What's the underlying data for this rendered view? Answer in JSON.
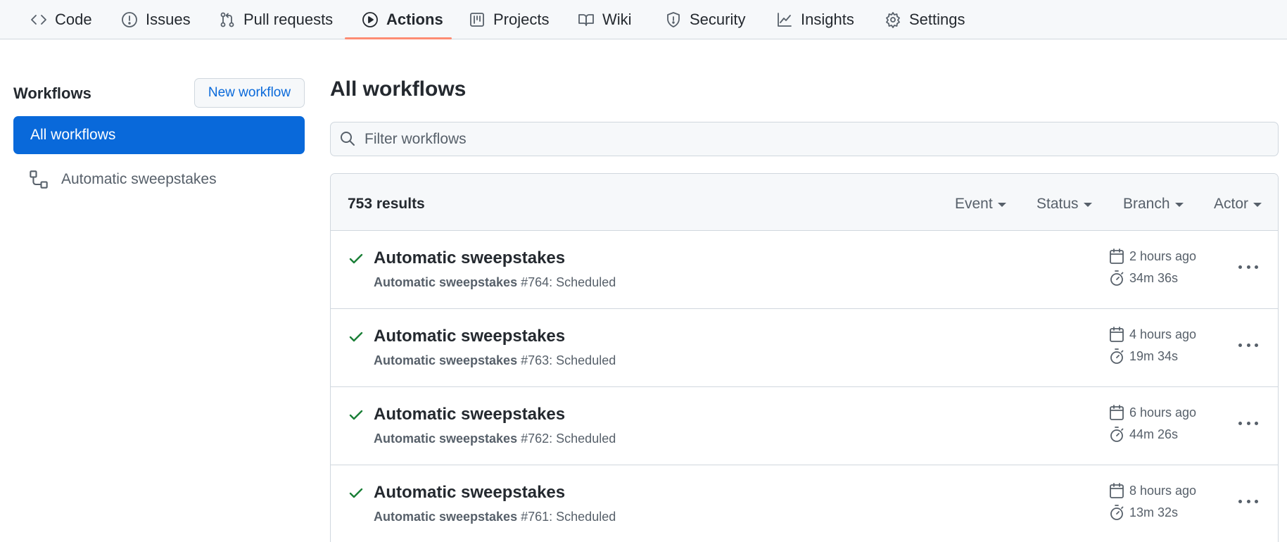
{
  "nav": {
    "tabs": [
      {
        "label": "Code",
        "icon": "code-icon"
      },
      {
        "label": "Issues",
        "icon": "issue-opened-icon"
      },
      {
        "label": "Pull requests",
        "icon": "git-pull-request-icon"
      },
      {
        "label": "Actions",
        "icon": "play-icon"
      },
      {
        "label": "Projects",
        "icon": "project-icon"
      },
      {
        "label": "Wiki",
        "icon": "book-icon"
      },
      {
        "label": "Security",
        "icon": "shield-icon"
      },
      {
        "label": "Insights",
        "icon": "graph-icon"
      },
      {
        "label": "Settings",
        "icon": "gear-icon"
      }
    ],
    "active_tab": "Actions",
    "accent_color": "#fd8c73"
  },
  "sidebar": {
    "title": "Workflows",
    "new_workflow_label": "New workflow",
    "all_workflows_label": "All workflows",
    "items": [
      {
        "label": "Automatic sweepstakes",
        "icon": "workflow-icon"
      }
    ],
    "active_color": "#0969da"
  },
  "main": {
    "title": "All workflows",
    "filter_placeholder": "Filter workflows",
    "results_count": "753 results",
    "filters": [
      "Event",
      "Status",
      "Branch",
      "Actor"
    ],
    "runs": [
      {
        "name": "Automatic sweepstakes",
        "workflow": "Automatic sweepstakes",
        "run": "#764: Scheduled",
        "time": "2 hours ago",
        "duration": "34m 36s",
        "status": "success"
      },
      {
        "name": "Automatic sweepstakes",
        "workflow": "Automatic sweepstakes",
        "run": "#763: Scheduled",
        "time": "4 hours ago",
        "duration": "19m 34s",
        "status": "success"
      },
      {
        "name": "Automatic sweepstakes",
        "workflow": "Automatic sweepstakes",
        "run": "#762: Scheduled",
        "time": "6 hours ago",
        "duration": "44m 26s",
        "status": "success"
      },
      {
        "name": "Automatic sweepstakes",
        "workflow": "Automatic sweepstakes",
        "run": "#761: Scheduled",
        "time": "8 hours ago",
        "duration": "13m 32s",
        "status": "success"
      }
    ],
    "success_color": "#1a7f37"
  }
}
